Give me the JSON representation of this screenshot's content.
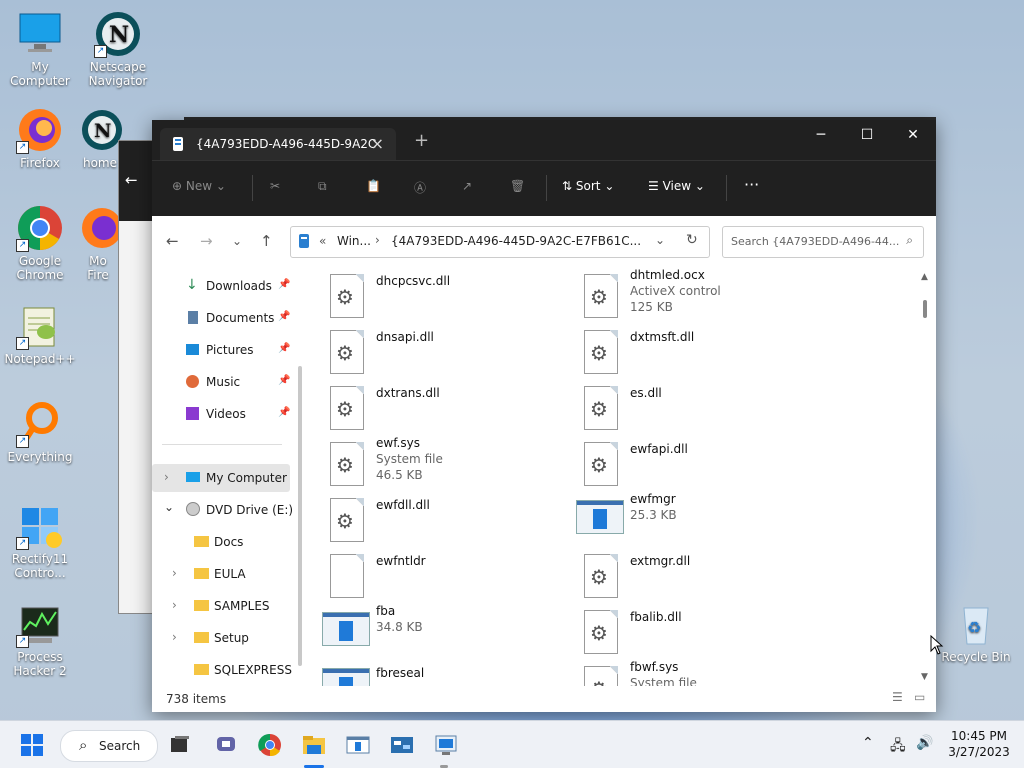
{
  "desktop": {
    "icons": [
      {
        "label": "My Computer",
        "name": "my-computer-desktop-icon"
      },
      {
        "label": "Netscape Navigator",
        "name": "netscape-desktop-icon"
      },
      {
        "label": "Firefox",
        "name": "firefox-desktop-icon"
      },
      {
        "label": "home",
        "name": "home-desktop-icon"
      },
      {
        "label": "Google Chrome",
        "name": "chrome-desktop-icon"
      },
      {
        "label": "Mo Fire",
        "name": "mozilla-firefox-desktop-icon"
      },
      {
        "label": "Notepad++",
        "name": "notepadpp-desktop-icon"
      },
      {
        "label": "Everything",
        "name": "everything-desktop-icon"
      },
      {
        "label": "Rectify11 Contro...",
        "name": "rectify11-desktop-icon"
      },
      {
        "label": "Process Hacker 2",
        "name": "process-hacker-desktop-icon"
      },
      {
        "label": "Recycle Bin",
        "name": "recycle-bin-desktop-icon"
      }
    ]
  },
  "explorer": {
    "tab_title": "{4A793EDD-A496-445D-9A2C",
    "toolbar": {
      "new_label": "New",
      "sort_label": "Sort",
      "view_label": "View",
      "more_label": "···"
    },
    "address": {
      "crumb_prefix": "«",
      "crumb1": "Win...",
      "crumb2": "{4A793EDD-A496-445D-9A2C-E7FB61C..."
    },
    "search_placeholder": "Search {4A793EDD-A496-44...",
    "sidebar": {
      "quick": [
        {
          "label": "Downloads",
          "icon": "download-icon"
        },
        {
          "label": "Documents",
          "icon": "documents-icon"
        },
        {
          "label": "Pictures",
          "icon": "pictures-icon"
        },
        {
          "label": "Music",
          "icon": "music-icon"
        },
        {
          "label": "Videos",
          "icon": "videos-icon"
        }
      ],
      "tree": [
        {
          "label": "My Computer"
        },
        {
          "label": "DVD Drive (E:) W"
        },
        {
          "label": "Docs"
        },
        {
          "label": "EULA"
        },
        {
          "label": "SAMPLES"
        },
        {
          "label": "Setup"
        },
        {
          "label": "SQLEXPRESS"
        }
      ]
    },
    "files": [
      {
        "name": "dhcpcsvc.dll",
        "sub1": "",
        "sub2": "",
        "kind": "dll"
      },
      {
        "name": "dhtmled.ocx",
        "sub1": "ActiveX control",
        "sub2": "125 KB",
        "kind": "dll"
      },
      {
        "name": "dnsapi.dll",
        "sub1": "",
        "sub2": "",
        "kind": "dll"
      },
      {
        "name": "dxtmsft.dll",
        "sub1": "",
        "sub2": "",
        "kind": "dll"
      },
      {
        "name": "dxtrans.dll",
        "sub1": "",
        "sub2": "",
        "kind": "dll"
      },
      {
        "name": "es.dll",
        "sub1": "",
        "sub2": "",
        "kind": "dll"
      },
      {
        "name": "ewf.sys",
        "sub1": "System file",
        "sub2": "46.5 KB",
        "kind": "dll"
      },
      {
        "name": "ewfapi.dll",
        "sub1": "",
        "sub2": "",
        "kind": "dll"
      },
      {
        "name": "ewfdll.dll",
        "sub1": "",
        "sub2": "",
        "kind": "dll"
      },
      {
        "name": "ewfmgr",
        "sub1": "25.3 KB",
        "sub2": "",
        "kind": "exe"
      },
      {
        "name": "ewfntldr",
        "sub1": "",
        "sub2": "",
        "kind": "blank"
      },
      {
        "name": "extmgr.dll",
        "sub1": "",
        "sub2": "",
        "kind": "dll"
      },
      {
        "name": "fba",
        "sub1": "34.8 KB",
        "sub2": "",
        "kind": "exe"
      },
      {
        "name": "fbalib.dll",
        "sub1": "",
        "sub2": "",
        "kind": "dll"
      },
      {
        "name": "fbreseal",
        "sub1": "",
        "sub2": "",
        "kind": "exe"
      },
      {
        "name": "fbwf.sys",
        "sub1": "System file",
        "sub2": "",
        "kind": "dll"
      }
    ],
    "status_count": "738 items"
  },
  "taskbar": {
    "search_label": "Search",
    "time": "10:45 PM",
    "date": "3/27/2023"
  }
}
